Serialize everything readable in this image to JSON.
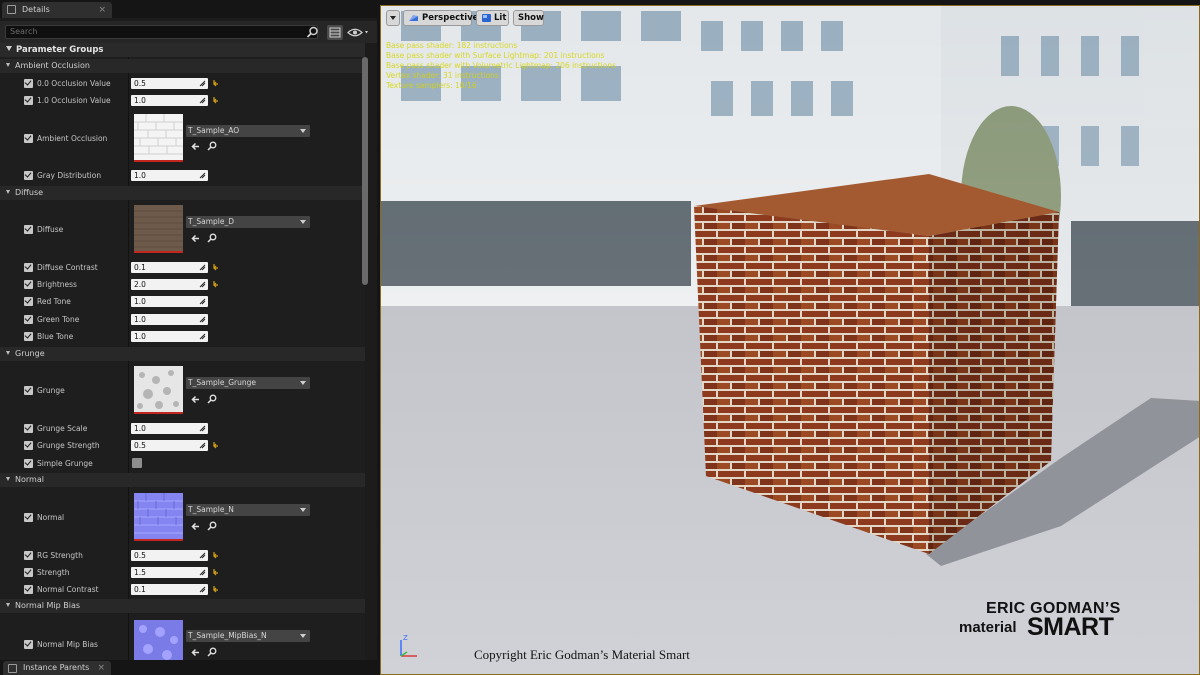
{
  "tabs": {
    "details": "Details",
    "instance_parents": "Instance Parents",
    "close_glyph": "×"
  },
  "search": {
    "placeholder": "Search"
  },
  "panel": {
    "header": "Parameter Groups",
    "categories": {
      "ambient_occlusion": "Ambient Occlusion",
      "diffuse": "Diffuse",
      "grunge": "Grunge",
      "normal": "Normal",
      "normal_mip_bias": "Normal Mip Bias"
    },
    "params": {
      "occ00": {
        "label": "0.0 Occlusion Value",
        "value": "0.5"
      },
      "occ10": {
        "label": "1.0 Occlusion Value",
        "value": "1.0"
      },
      "ambient_occlusion": {
        "label": "Ambient Occlusion",
        "texture": "T_Sample_AO"
      },
      "gray_distribution": {
        "label": "Gray Distribution",
        "value": "1.0"
      },
      "diffuse": {
        "label": "Diffuse",
        "texture": "T_Sample_D"
      },
      "diffuse_contrast": {
        "label": "Diffuse Contrast",
        "value": "0.1"
      },
      "brightness": {
        "label": "Brightness",
        "value": "2.0"
      },
      "red_tone": {
        "label": "Red Tone",
        "value": "1.0"
      },
      "green_tone": {
        "label": "Green Tone",
        "value": "1.0"
      },
      "blue_tone": {
        "label": "Blue Tone",
        "value": "1.0"
      },
      "grunge": {
        "label": "Grunge",
        "texture": "T_Sample_Grunge"
      },
      "grunge_scale": {
        "label": "Grunge Scale",
        "value": "1.0"
      },
      "grunge_strength": {
        "label": "Grunge Strength",
        "value": "0.5"
      },
      "simple_grunge": {
        "label": "Simple Grunge"
      },
      "normal": {
        "label": "Normal",
        "texture": "T_Sample_N"
      },
      "rg_strength": {
        "label": "RG Strength",
        "value": "0.5"
      },
      "strength": {
        "label": "Strength",
        "value": "1.5"
      },
      "normal_contrast": {
        "label": "Normal Contrast",
        "value": "0.1"
      },
      "normal_mip_bias": {
        "label": "Normal Mip Bias",
        "texture": "T_Sample_MipBias_N"
      }
    }
  },
  "viewport": {
    "perspective": "Perspective",
    "lit": "Lit",
    "show": "Show",
    "stats": [
      "Base pass shader: 182 instructions",
      "Base pass shader with Surface Lightmap: 201 instructions",
      "Base pass shader with Volumetric Lightmap: 206 instructions",
      "Vertex shader: 31 instructions",
      "Texture samplers: 10/16"
    ],
    "stats_color": "#d6d600",
    "axis_z": "Z"
  },
  "overlay": {
    "copyright": "Copyright Eric Godman’s Material Smart",
    "logo_line1": "ERIC GODMAN’S",
    "logo_material": "material",
    "logo_smart": "SMART"
  },
  "colors": {
    "panel_bg": "#1e1e1e",
    "field_bg": "#f2f2f2",
    "reset_arrow": "#d4a017",
    "texture_border": "#c3251f"
  }
}
